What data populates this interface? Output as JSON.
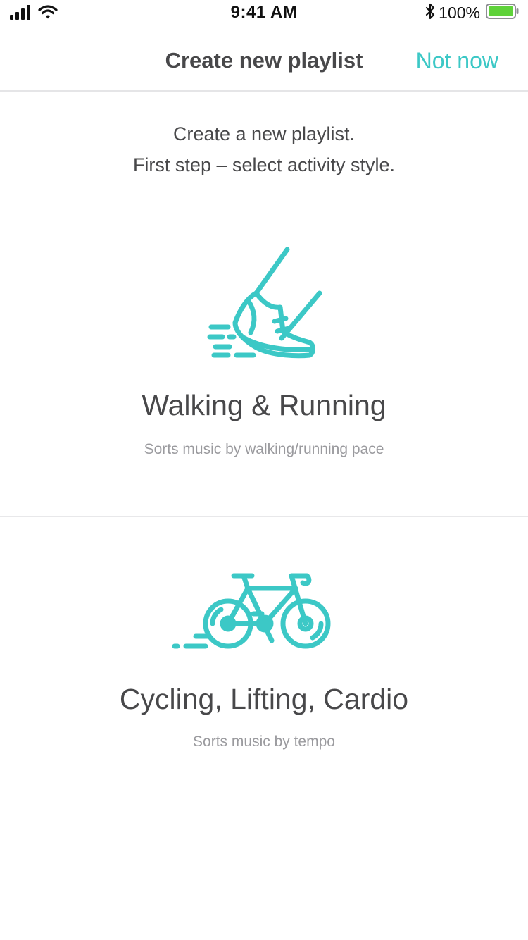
{
  "status_bar": {
    "time": "9:41 AM",
    "battery_percent": "100%"
  },
  "nav": {
    "title": "Create new playlist",
    "action_label": "Not now"
  },
  "intro": {
    "line1": "Create a new playlist.",
    "line2": "First step – select activity style."
  },
  "options": [
    {
      "icon": "running-shoe-icon",
      "title": "Walking & Running",
      "subtitle": "Sorts music by walking/running pace"
    },
    {
      "icon": "bicycle-icon",
      "title": "Cycling, Lifting, Cardio",
      "subtitle": "Sorts music by tempo"
    }
  ],
  "colors": {
    "accent": "#3cc8c6",
    "battery": "#5fd23a",
    "title_text": "#48484a",
    "subtitle_text": "#9a9a9e"
  }
}
